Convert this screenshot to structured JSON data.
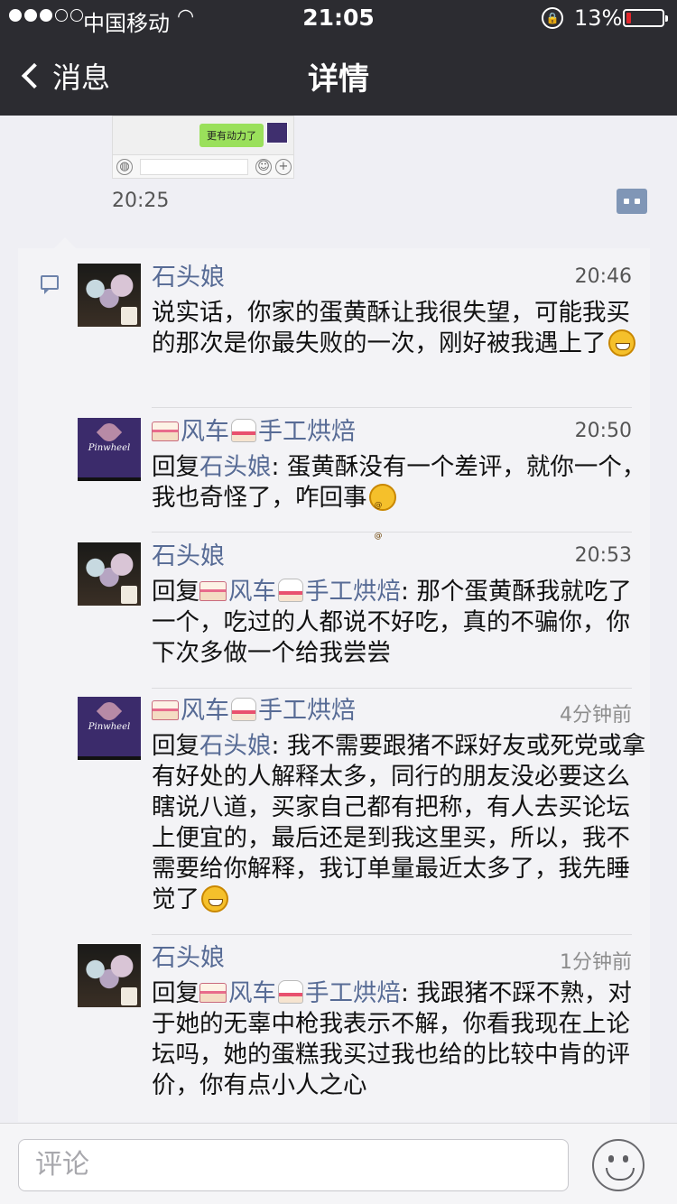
{
  "status_bar": {
    "carrier": "中国移动",
    "time": "21:05",
    "battery": "13%",
    "battery_level": 0.13
  },
  "nav": {
    "back_label": "消息",
    "title": "详情"
  },
  "moment": {
    "thumbnail_bubble": "更有动力了",
    "time": "20:25"
  },
  "comments": [
    {
      "author": "石头娘",
      "time": "20:46",
      "reply_to": "",
      "text": "说实话，你家的蛋黄酥让我很失望，可能我买的那次是你最失败的一次，刚好被我遇上了",
      "avatar": "flowers",
      "emoji": "grin-icon"
    },
    {
      "author": "风车",
      "author_suffix": "手工烘焙",
      "time": "20:50",
      "reply_prefix": "回复",
      "reply_to": "石头娘",
      "text": ": 蛋黄酥没有一个差评，就你一个，我也奇怪了，咋回事",
      "avatar": "brand",
      "emoji": "dizzy-icon"
    },
    {
      "author": "石头娘",
      "time": "20:53",
      "reply_prefix": "回复",
      "reply_to": "风车",
      "reply_to_suffix": "手工烘焙",
      "text": ": 那个蛋黄酥我就吃了一个，吃过的人都说不好吃，真的不骗你，你下次多做一个给我尝尝",
      "avatar": "flowers"
    },
    {
      "author": "风车",
      "author_suffix": "手工烘焙",
      "time": "4分钟前",
      "reply_prefix": "回复",
      "reply_to": "石头娘",
      "text": ": 我不需要跟猪不踩好友或死党或拿有好处的人解释太多，同行的朋友没必要这么瞎说八道，买家自己都有把称，有人去买论坛上便宜的，最后还是到我这里买，所以，我不需要给你解释，我订单量最近太多了，我先睡觉了",
      "avatar": "brand",
      "emoji": "grin-icon"
    },
    {
      "author": "石头娘",
      "time": "1分钟前",
      "reply_prefix": "回复",
      "reply_to": "风车",
      "reply_to_suffix": "手工烘焙",
      "text": ": 我跟猪不踩不熟，对于她的无辜中枪我表示不解，你看我现在上论坛吗，她的蛋糕我买过我也给的比较中肯的评价，你有点小人之心",
      "avatar": "flowers"
    }
  ],
  "input": {
    "placeholder": "评论"
  },
  "colors": {
    "nav_bg": "#2c2c31",
    "link": "#576b95",
    "battery_low": "#e2262b"
  }
}
